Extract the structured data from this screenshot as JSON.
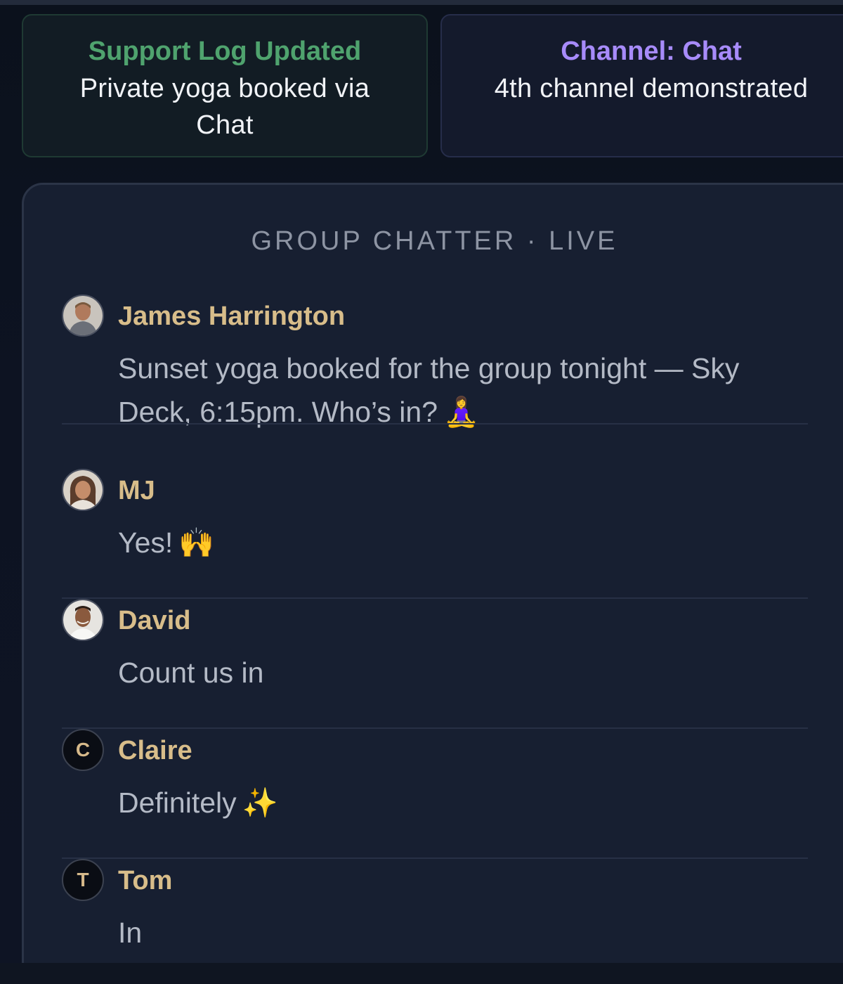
{
  "cards": {
    "support": {
      "title": "Support Log Updated",
      "body": "Private yoga booked via Chat"
    },
    "channel": {
      "title": "Channel: Chat",
      "body": "4th channel demonstrated"
    }
  },
  "panel": {
    "title": "GROUP CHATTER · LIVE",
    "messages": [
      {
        "author": "James Harrington",
        "text": "Sunset yoga booked for the group tonight — Sky Deck, 6:15pm. Who’s in?",
        "emoji": "🧘‍♀️",
        "avatar": "photo"
      },
      {
        "author": "MJ",
        "text": "Yes!",
        "emoji": "🙌",
        "avatar": "photo"
      },
      {
        "author": "David",
        "text": "Count us in",
        "emoji": "",
        "avatar": "photo"
      },
      {
        "author": "Claire",
        "text": "Definitely",
        "emoji": "✨",
        "avatar": "C"
      },
      {
        "author": "Tom",
        "text": "In",
        "emoji": "",
        "avatar": "T"
      }
    ]
  },
  "colors": {
    "accent_green": "#4fa36e",
    "accent_purple": "#a78bfa",
    "author_gold": "#d8bd8a",
    "panel_bg": "#171f31"
  }
}
